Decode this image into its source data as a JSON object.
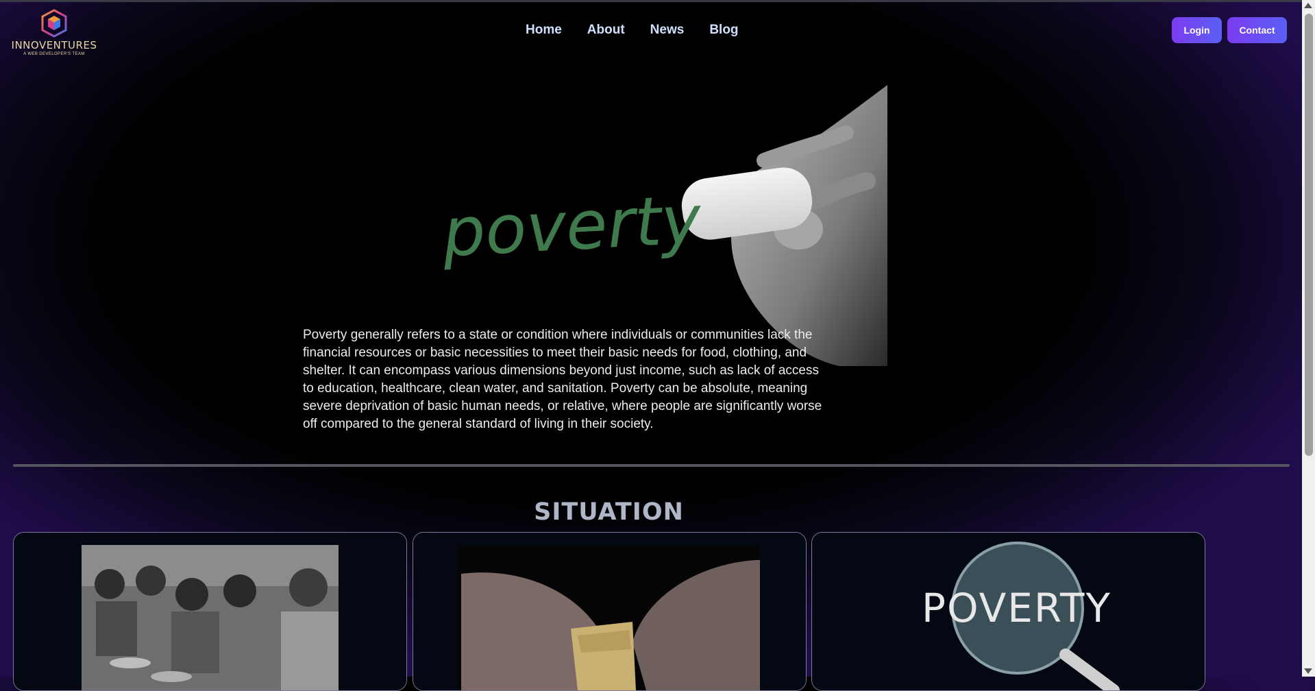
{
  "header": {
    "logo": {
      "name": "INNOVENTURES",
      "tagline": "A WEB DEVELOPER'S TEAM"
    },
    "nav": [
      {
        "label": "Home"
      },
      {
        "label": "About"
      },
      {
        "label": "News"
      },
      {
        "label": "Blog"
      }
    ],
    "login_label": "Login",
    "contact_label": "Contact"
  },
  "hero": {
    "image_text": "poverty",
    "description": "Poverty generally refers to a state or condition where individuals or communities lack the financial resources or basic necessities to meet their basic needs for food, clothing, and shelter. It can encompass various dimensions beyond just income, such as lack of access to education, healthcare, clean water, and sanitation. Poverty can be absolute, meaning severe deprivation of basic human needs, or relative, where people are significantly worse off compared to the general standard of living in their society."
  },
  "situation": {
    "title": "SITUATION",
    "cards": [
      {
        "image": "children-photo"
      },
      {
        "image": "hands-bread-photo"
      },
      {
        "image": "magnifier-poverty-photo",
        "image_text": "POVERTY"
      }
    ]
  },
  "colors": {
    "accent": "#6a4ff3",
    "nav_text": "#cfe0ff",
    "chalk_green": "#3f7a4c"
  }
}
